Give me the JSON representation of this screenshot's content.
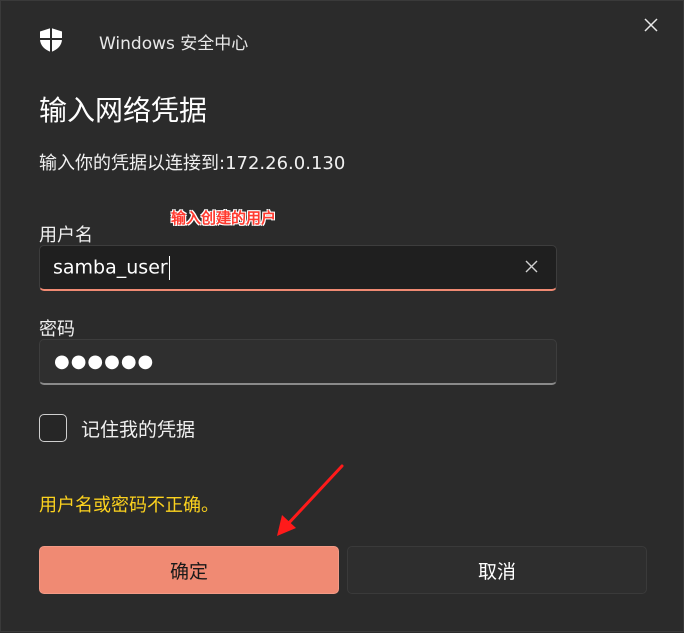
{
  "app": {
    "title": "Windows 安全中心",
    "icon": "shield-icon"
  },
  "dialog": {
    "heading": "输入网络凭据",
    "subtitle": "输入你的凭据以连接到:172.26.0.130",
    "annotation": "输入创建的用户"
  },
  "fields": {
    "username": {
      "label": "用户名",
      "value": "samba_user"
    },
    "password": {
      "label": "密码",
      "value": "●●●●●●"
    }
  },
  "remember": {
    "label": "记住我的凭据",
    "checked": false
  },
  "error_message": "用户名或密码不正确。",
  "buttons": {
    "ok": "确定",
    "cancel": "取消"
  },
  "colors": {
    "accent": "#f08a73",
    "error": "#fcd21e",
    "annotation": "#ff3b30",
    "background": "#2b2b2b"
  }
}
